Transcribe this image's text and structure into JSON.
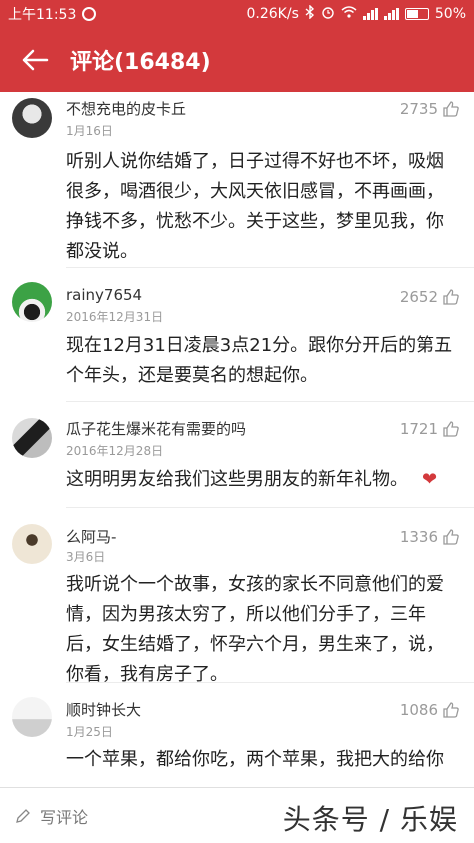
{
  "status": {
    "time": "上午11:53",
    "speed": "0.26K/s",
    "battery": "50%"
  },
  "header": {
    "title": "评论(16484)"
  },
  "comments": [
    {
      "name": "不想充电的皮卡丘",
      "date": "1月16日",
      "likes": "2735",
      "body": "听别人说你结婚了，日子过得不好也不坏，吸烟很多，喝酒很少，大风天依旧感冒，不再画画，挣钱不多，忧愁不少。关于这些，梦里见我，你都没说。"
    },
    {
      "name": "rainy7654",
      "date": "2016年12月31日",
      "likes": "2652",
      "body": "现在12月31日凌晨3点21分。跟你分开后的第五个年头，还是要莫名的想起你。"
    },
    {
      "name": "瓜子花生爆米花有需要的吗",
      "date": "2016年12月28日",
      "likes": "1721",
      "body": "这明明男友给我们这些男朋友的新年礼物。"
    },
    {
      "name": "么阿马-",
      "date": "3月6日",
      "likes": "1336",
      "body": "我听说个一个故事，女孩的家长不同意他们的爱情，因为男孩太穷了，所以他们分手了，三年后，女生结婚了，怀孕六个月，男生来了，说，你看，我有房子了。"
    },
    {
      "name": "顺时钟长大",
      "date": "1月25日",
      "likes": "1086",
      "body": "一个苹果，都给你吃，两个苹果，我把大的给你"
    }
  ],
  "bottom": {
    "write_label": "写评论",
    "watermark": "头条号 / 乐娱"
  },
  "colors": {
    "brand": "#d3393c"
  }
}
